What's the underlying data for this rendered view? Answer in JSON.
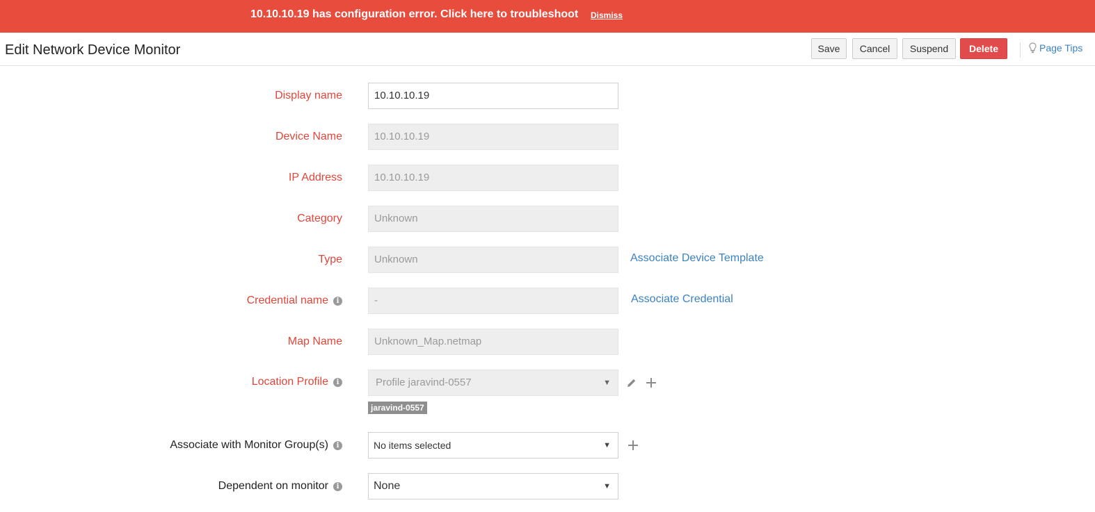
{
  "banner": {
    "message": "10.10.10.19 has configuration error. Click here to troubleshoot",
    "dismiss": "Dismiss"
  },
  "header": {
    "title": "Edit Network Device Monitor",
    "buttons": {
      "save": "Save",
      "cancel": "Cancel",
      "suspend": "Suspend",
      "delete": "Delete"
    },
    "page_tips": "Page Tips"
  },
  "form": {
    "display_name": {
      "label": "Display name",
      "value": "10.10.10.19"
    },
    "device_name": {
      "label": "Device Name",
      "value": "10.10.10.19"
    },
    "ip_address": {
      "label": "IP Address",
      "value": "10.10.10.19"
    },
    "category": {
      "label": "Category",
      "value": "Unknown"
    },
    "type": {
      "label": "Type",
      "value": "Unknown",
      "link": "Associate Device Template"
    },
    "credential": {
      "label": "Credential name",
      "value": "-",
      "link": "Associate Credential"
    },
    "map_name": {
      "label": "Map Name",
      "value": "Unknown_Map.netmap"
    },
    "location_profile": {
      "label": "Location Profile",
      "value": "Profile jaravind-0557",
      "tag": "jaravind-0557"
    },
    "monitor_groups": {
      "label": "Associate with Monitor Group(s)",
      "value": "No items selected"
    },
    "dependent_on": {
      "label": "Dependent on monitor",
      "value": "None"
    }
  },
  "colors": {
    "banner_bg": "#e84c3d",
    "required_label": "#e2463b",
    "link": "#3b82c4",
    "delete_button": "#e14b4b"
  },
  "icons": [
    "info-icon",
    "lightbulb-icon",
    "pencil-icon",
    "plus-icon",
    "chevron-down-icon"
  ]
}
